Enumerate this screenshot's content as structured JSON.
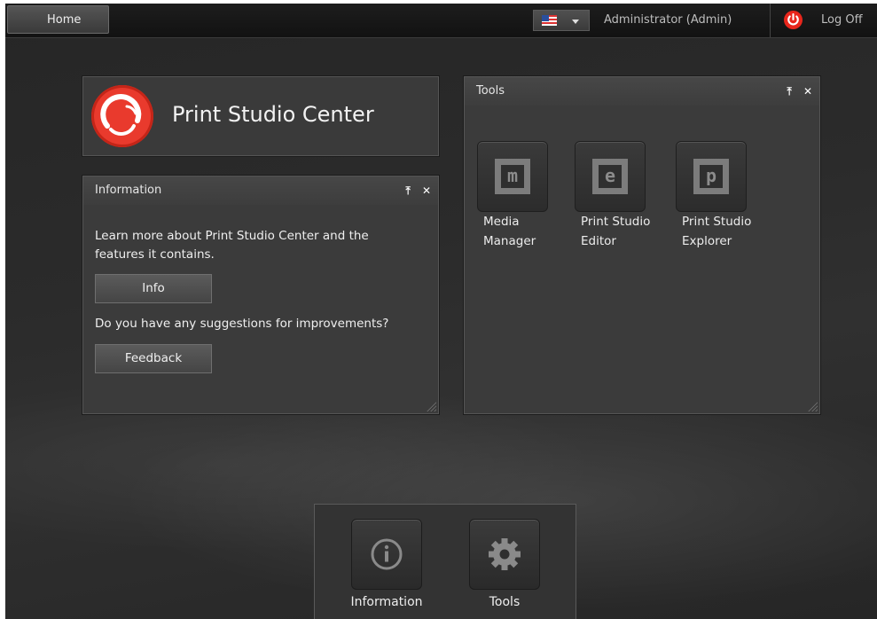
{
  "topbar": {
    "home_label": "Home",
    "language_flag": "us-flag-icon",
    "user_label": "Administrator (Admin)",
    "logoff_label": "Log Off"
  },
  "app": {
    "title": "Print Studio Center",
    "logo_color": "#e93a2d"
  },
  "information_panel": {
    "title": "Information",
    "text1": "Learn more about Print Studio Center and the",
    "text2": "features it contains.",
    "info_button": "Info",
    "question": "Do you have any suggestions for improvements?",
    "feedback_button": "Feedback"
  },
  "tools_panel": {
    "title": "Tools",
    "tools": [
      {
        "glyph": "m",
        "line1": "Media",
        "line2": "Manager"
      },
      {
        "glyph": "e",
        "line1": "Print Studio",
        "line2": "Editor"
      },
      {
        "glyph": "p",
        "line1": "Print Studio",
        "line2": "Explorer"
      }
    ]
  },
  "dock": {
    "items": [
      {
        "label": "Information",
        "icon": "info-icon"
      },
      {
        "label": "Tools",
        "icon": "gear-icon"
      }
    ]
  },
  "colors": {
    "accent_red": "#e93a2d",
    "panel_bg": "#3b3b3b",
    "background": "#2b2b2b"
  }
}
